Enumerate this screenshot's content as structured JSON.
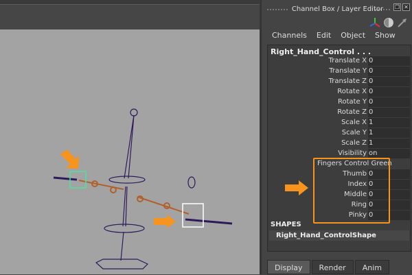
{
  "panel": {
    "title": "Channel Box / Layer Editor",
    "menu": [
      "Channels",
      "Edit",
      "Object",
      "Show"
    ],
    "object_name": "Right_Hand_Control . . .",
    "channels": [
      {
        "label": "Translate X",
        "value": "0"
      },
      {
        "label": "Translate Y",
        "value": "0"
      },
      {
        "label": "Translate Z",
        "value": "0"
      },
      {
        "label": "Rotate X",
        "value": "0"
      },
      {
        "label": "Rotate Y",
        "value": "0"
      },
      {
        "label": "Rotate Z",
        "value": "0"
      },
      {
        "label": "Scale X",
        "value": "1"
      },
      {
        "label": "Scale Y",
        "value": "1"
      },
      {
        "label": "Scale Z",
        "value": "1"
      },
      {
        "label": "Visibility",
        "value": "on"
      }
    ],
    "custom_header": "Fingers Control Green",
    "fingers": [
      {
        "label": "Thumb",
        "value": "0"
      },
      {
        "label": "Index",
        "value": "0"
      },
      {
        "label": "Middle",
        "value": "0"
      },
      {
        "label": "Ring",
        "value": "0"
      },
      {
        "label": "Pinky",
        "value": "0"
      }
    ],
    "shapes_header": "SHAPES",
    "shape_name": "Right_Hand_ControlShape",
    "tabs": [
      "Display",
      "Render",
      "Anim"
    ],
    "active_tab": "Display"
  },
  "colors": {
    "highlight": "#f7941d",
    "joint": "#2e1a5a",
    "bone": "#b0602a",
    "left_control": "#4fe0a0",
    "right_control": "#ffffff"
  }
}
